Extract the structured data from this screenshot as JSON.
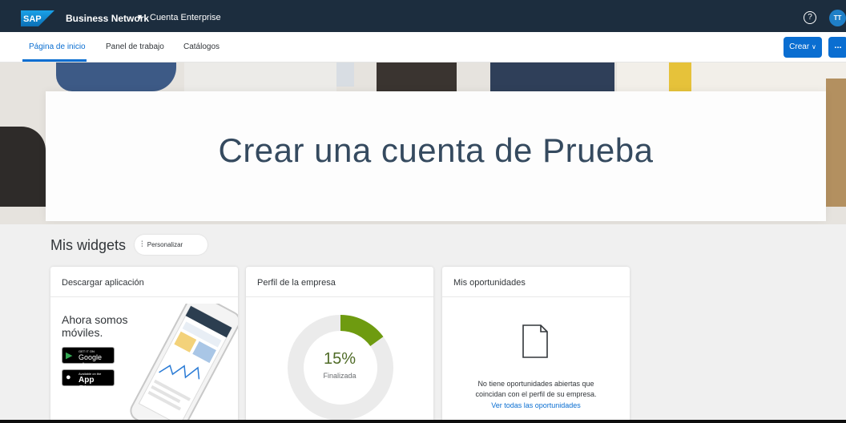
{
  "header": {
    "logo_text": "SAP",
    "brand": "Business Network",
    "account": "Cuenta Enterprise",
    "user_initials": "TT"
  },
  "nav": {
    "tabs": [
      {
        "label": "Página de inicio",
        "active": true
      },
      {
        "label": "Panel de trabajo",
        "active": false
      },
      {
        "label": "Catálogos",
        "active": false
      }
    ],
    "create_label": "Crear",
    "more_label": "..."
  },
  "hero": {
    "title": "Crear una cuenta de Prueba"
  },
  "widgets": {
    "heading": "Mis widgets",
    "personalize_label": "Personalizar",
    "cards": [
      {
        "title": "Descargar aplicación",
        "text_line1": "Ahora somos",
        "text_line2": "móviles.",
        "google_small": "GET IT ON",
        "google_big": "Google play",
        "apple_small": "Available on the",
        "apple_big": "App Store"
      },
      {
        "title": "Perfil de la empresa",
        "percent_text": "15%",
        "percent_value": 15,
        "status_label": "Finalizada"
      },
      {
        "title": "Mis oportunidades",
        "message_line1": "No tiene oportunidades abiertas que",
        "message_line2": "coincidan con el perfil de su empresa.",
        "link": "Ver todas las oportunidades"
      }
    ]
  },
  "colors": {
    "shell": "#1c2d3e",
    "accent": "#0a6ed1",
    "progress": "#6e9b10",
    "progress_track": "#ebebeb",
    "hero_title": "#354a5f"
  }
}
